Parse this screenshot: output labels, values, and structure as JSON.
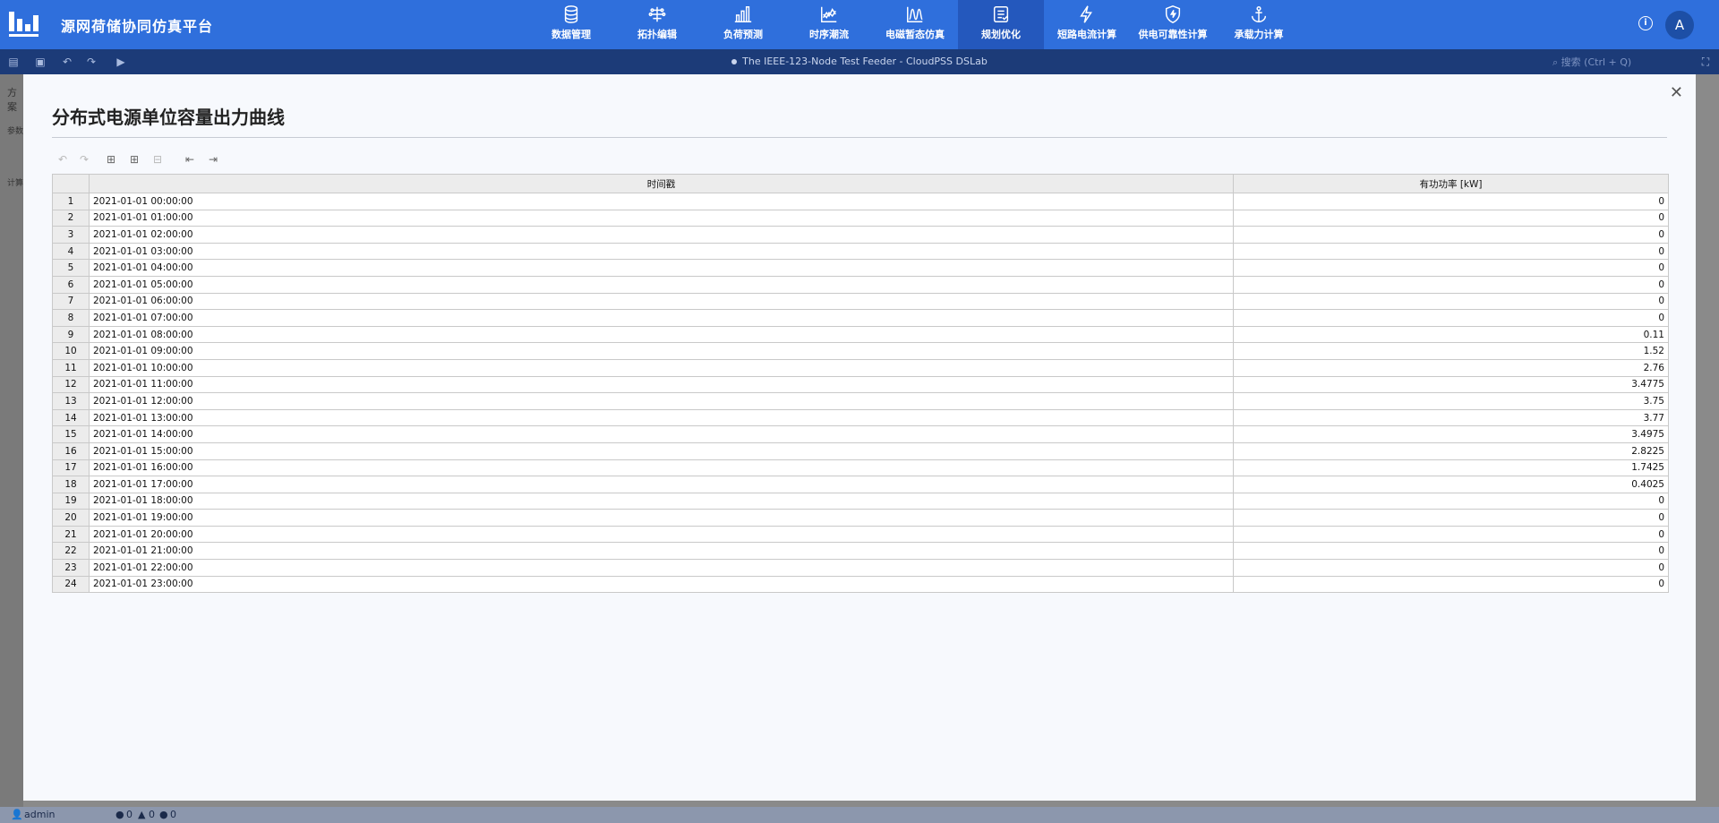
{
  "app": {
    "title": "源网荷储协同仿真平台",
    "user_initial": "A"
  },
  "nav": [
    {
      "label": "数据管理",
      "icon": "database-icon"
    },
    {
      "label": "拓扑编辑",
      "icon": "topology-icon"
    },
    {
      "label": "负荷预测",
      "icon": "bar-chart-icon"
    },
    {
      "label": "时序潮流",
      "icon": "line-chart-icon"
    },
    {
      "label": "电磁暂态仿真",
      "icon": "waveform-icon"
    },
    {
      "label": "规划优化",
      "icon": "planning-icon",
      "active": true
    },
    {
      "label": "短路电流计算",
      "icon": "lightning-icon"
    },
    {
      "label": "供电可靠性计算",
      "icon": "shield-icon"
    },
    {
      "label": "承载力计算",
      "icon": "anchor-icon"
    }
  ],
  "subbar": {
    "document_title": "The IEEE-123-Node Test Feeder - CloudPSS DSLab",
    "search_placeholder": "搜索 (Ctrl + Q)"
  },
  "left_strip": {
    "tab": "方案",
    "section1": "参数",
    "section2": "计算"
  },
  "status": {
    "user": "admin",
    "errors": "0",
    "warnings": "0",
    "infos": "0"
  },
  "modal": {
    "title": "分布式电源单位容量出力曲线",
    "columns": [
      "",
      "时间戳",
      "有功功率 [kW]"
    ],
    "rows": [
      [
        "1",
        "2021-01-01 00:00:00",
        "0"
      ],
      [
        "2",
        "2021-01-01 01:00:00",
        "0"
      ],
      [
        "3",
        "2021-01-01 02:00:00",
        "0"
      ],
      [
        "4",
        "2021-01-01 03:00:00",
        "0"
      ],
      [
        "5",
        "2021-01-01 04:00:00",
        "0"
      ],
      [
        "6",
        "2021-01-01 05:00:00",
        "0"
      ],
      [
        "7",
        "2021-01-01 06:00:00",
        "0"
      ],
      [
        "8",
        "2021-01-01 07:00:00",
        "0"
      ],
      [
        "9",
        "2021-01-01 08:00:00",
        "0.11"
      ],
      [
        "10",
        "2021-01-01 09:00:00",
        "1.52"
      ],
      [
        "11",
        "2021-01-01 10:00:00",
        "2.76"
      ],
      [
        "12",
        "2021-01-01 11:00:00",
        "3.4775"
      ],
      [
        "13",
        "2021-01-01 12:00:00",
        "3.75"
      ],
      [
        "14",
        "2021-01-01 13:00:00",
        "3.77"
      ],
      [
        "15",
        "2021-01-01 14:00:00",
        "3.4975"
      ],
      [
        "16",
        "2021-01-01 15:00:00",
        "2.8225"
      ],
      [
        "17",
        "2021-01-01 16:00:00",
        "1.7425"
      ],
      [
        "18",
        "2021-01-01 17:00:00",
        "0.4025"
      ],
      [
        "19",
        "2021-01-01 18:00:00",
        "0"
      ],
      [
        "20",
        "2021-01-01 19:00:00",
        "0"
      ],
      [
        "21",
        "2021-01-01 20:00:00",
        "0"
      ],
      [
        "22",
        "2021-01-01 21:00:00",
        "0"
      ],
      [
        "23",
        "2021-01-01 22:00:00",
        "0"
      ],
      [
        "24",
        "2021-01-01 23:00:00",
        "0"
      ]
    ]
  },
  "colors": {
    "nav_bg": "#2f6fdc",
    "nav_active": "#2458bd",
    "subbar_bg": "#1c3b78"
  }
}
